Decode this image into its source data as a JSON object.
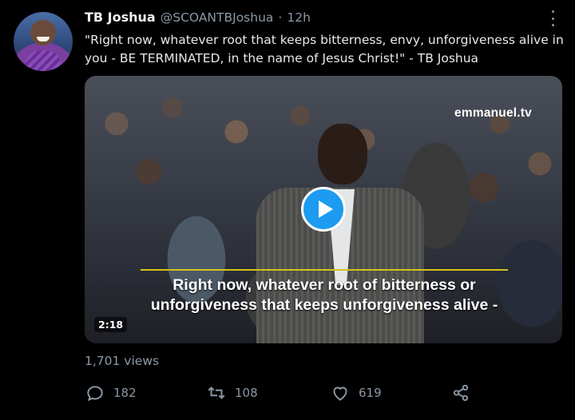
{
  "tweet": {
    "display_name": "TB Joshua",
    "handle": "@SCOANTBJoshua",
    "separator": "·",
    "time": "12h",
    "text": "\"Right now, whatever root that keeps bitterness, envy, unforgiveness alive in you - BE TERMINATED, in the name of Jesus Christ!\" - TB Joshua"
  },
  "media": {
    "logo": "emmanuel.tv",
    "caption_line1": "Right now, whatever root of bitterness or",
    "caption_line2": "unforgiveness that keeps unforgiveness alive -",
    "duration": "2:18"
  },
  "stats": {
    "views": "1,701 views",
    "replies": "182",
    "retweets": "108",
    "likes": "619"
  },
  "icons": [
    "avatar",
    "more-icon",
    "play-icon",
    "reply-icon",
    "retweet-icon",
    "like-icon",
    "share-icon"
  ],
  "colors": {
    "background": "#000000",
    "text": "#e7e9ea",
    "muted": "#8b98a5",
    "accent": "#1d9bf0"
  }
}
